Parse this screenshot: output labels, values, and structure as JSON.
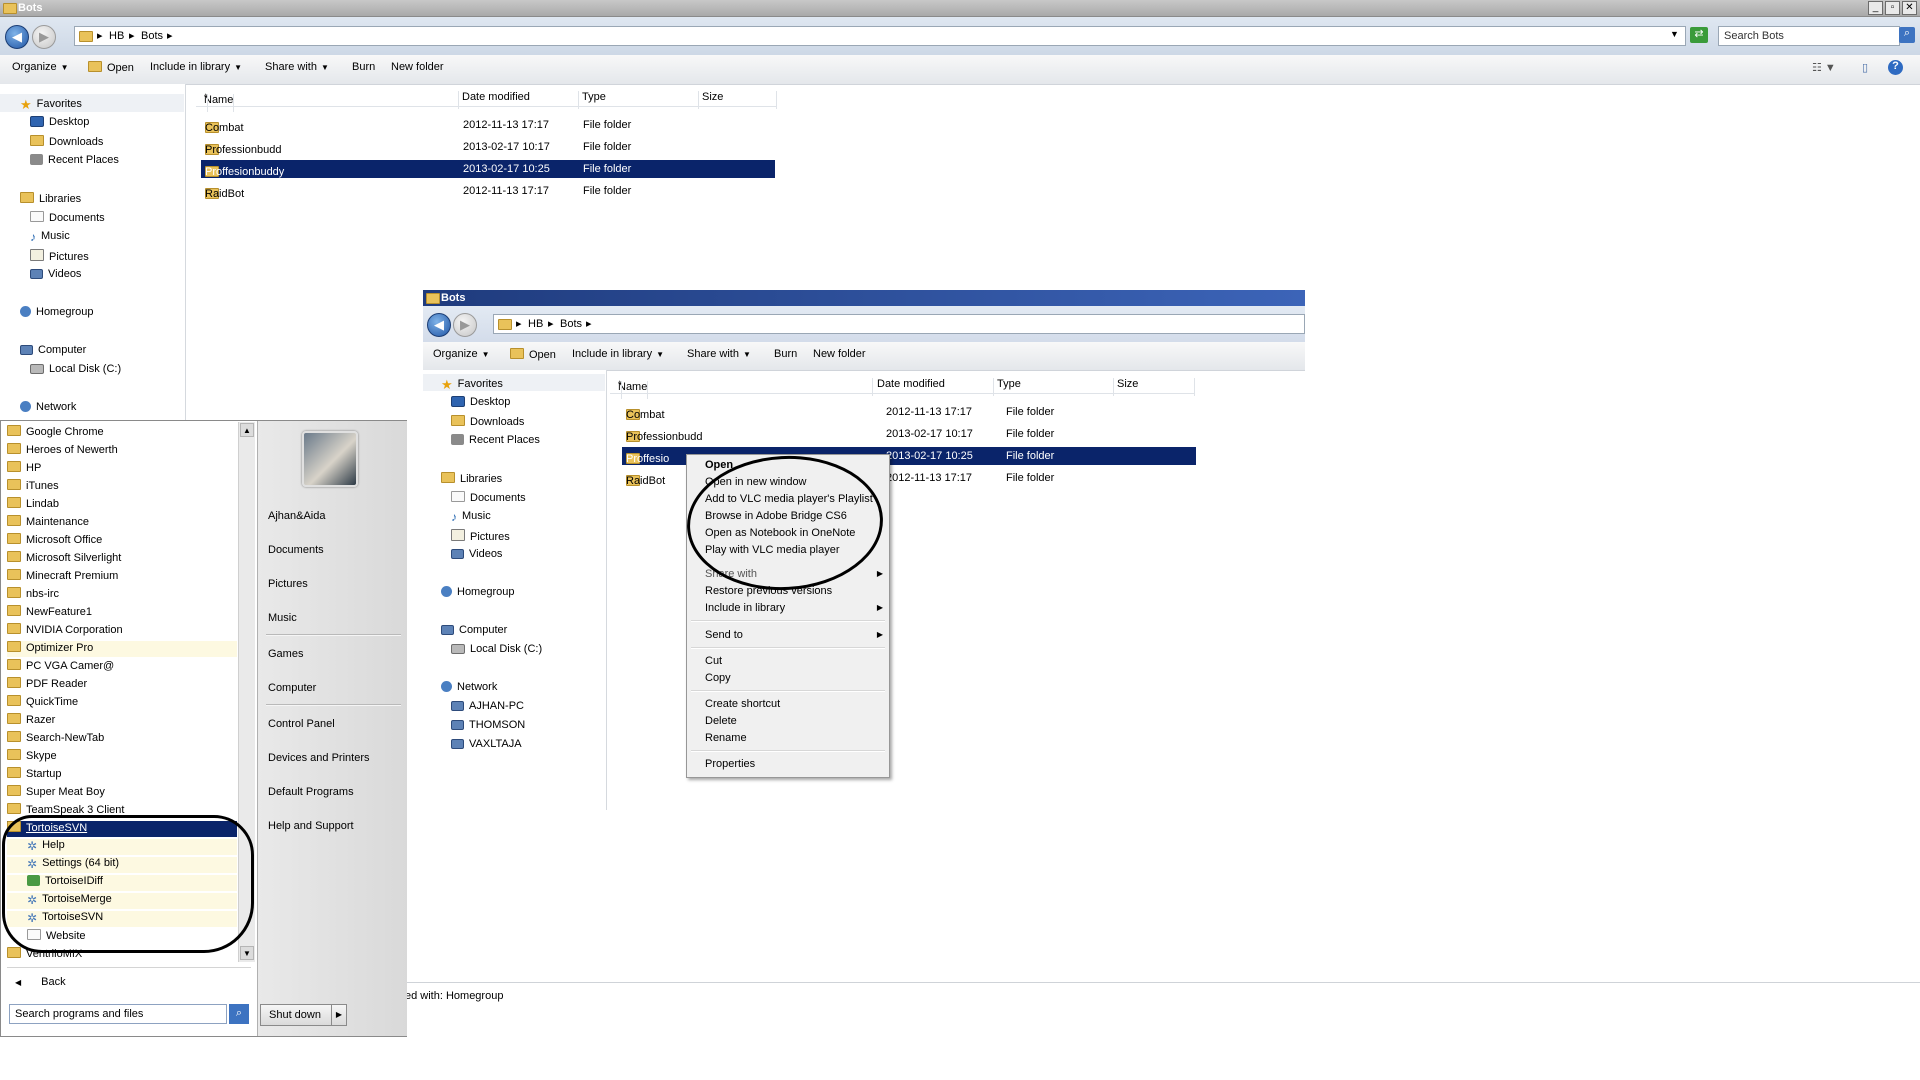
{
  "outer": {
    "title": "Bots",
    "breadcrumb": [
      "HB",
      "Bots"
    ],
    "search_placeholder": "Search Bots",
    "toolbar": {
      "organize": "Organize",
      "open": "Open",
      "include": "Include in library",
      "share": "Share with",
      "burn": "Burn",
      "new_folder": "New folder"
    },
    "nav": {
      "favorites": "Favorites",
      "desktop": "Desktop",
      "downloads": "Downloads",
      "recent": "Recent Places",
      "libraries": "Libraries",
      "documents": "Documents",
      "music": "Music",
      "pictures": "Pictures",
      "videos": "Videos",
      "homegroup": "Homegroup",
      "computer": "Computer",
      "localdisk": "Local Disk (C:)",
      "network": "Network"
    },
    "columns": {
      "name": "Name",
      "date": "Date modified",
      "type": "Type",
      "size": "Size"
    },
    "rows": [
      {
        "name": "Combat",
        "date": "2012-11-13 17:17",
        "type": "File folder"
      },
      {
        "name": "Professionbudd",
        "date": "2013-02-17 10:17",
        "type": "File folder"
      },
      {
        "name": "Proffesionbuddy",
        "date": "2013-02-17 10:25",
        "type": "File folder"
      },
      {
        "name": "RaidBot",
        "date": "2012-11-13 17:17",
        "type": "File folder"
      }
    ]
  },
  "inner": {
    "title": "Bots",
    "breadcrumb": [
      "HB",
      "Bots"
    ],
    "toolbar": {
      "organize": "Organize",
      "open": "Open",
      "include": "Include in library",
      "share": "Share with",
      "burn": "Burn",
      "new_folder": "New folder"
    },
    "nav": {
      "favorites": "Favorites",
      "desktop": "Desktop",
      "downloads": "Downloads",
      "recent": "Recent Places",
      "libraries": "Libraries",
      "documents": "Documents",
      "music": "Music",
      "pictures": "Pictures",
      "videos": "Videos",
      "homegroup": "Homegroup",
      "computer": "Computer",
      "localdisk": "Local Disk (C:)",
      "network": "Network",
      "pc1": "AJHAN-PC",
      "pc2": "THOMSON",
      "pc3": "VAXLTAJA"
    },
    "columns": {
      "name": "Name",
      "date": "Date modified",
      "type": "Type",
      "size": "Size"
    },
    "rows": [
      {
        "name": "Combat",
        "date": "2012-11-13 17:17",
        "type": "File folder"
      },
      {
        "name": "Professionbudd",
        "date": "2013-02-17 10:17",
        "type": "File folder"
      },
      {
        "name": "Proffesio",
        "date": "2013-02-17 10:25",
        "type": "File folder"
      },
      {
        "name": "RaidBot",
        "date": "2012-11-13 17:17",
        "type": "File folder"
      }
    ],
    "status": "ed with: Homegroup"
  },
  "context_menu": {
    "open": "Open",
    "open_new": "Open in new window",
    "vlc_add": "Add to VLC media player's Playlist",
    "bridge": "Browse in Adobe Bridge CS6",
    "onenote": "Open as Notebook in OneNote",
    "vlc_play": "Play with VLC media player",
    "share": "Share with",
    "restore": "Restore previous versions",
    "include": "Include in library",
    "send": "Send to",
    "cut": "Cut",
    "copy": "Copy",
    "shortcut": "Create shortcut",
    "delete": "Delete",
    "rename": "Rename",
    "properties": "Properties"
  },
  "start_menu": {
    "programs": [
      "Google Chrome",
      "Heroes of Newerth",
      "HP",
      "iTunes",
      "Lindab",
      "Maintenance",
      "Microsoft Office",
      "Microsoft Silverlight",
      "Minecraft Premium",
      "nbs-irc",
      "NewFeature1",
      "NVIDIA Corporation",
      "Optimizer Pro",
      "PC VGA Camer@",
      "PDF Reader",
      "QuickTime",
      "Razer",
      "Search-NewTab",
      "Skype",
      "Startup",
      "Super Meat Boy",
      "TeamSpeak 3 Client",
      "TortoiseSVN"
    ],
    "tortoise_items": [
      "Help",
      "Settings (64 bit)",
      "TortoiseIDiff",
      "TortoiseMerge",
      "TortoiseSVN",
      "Website"
    ],
    "last_program": "VentriloMIX",
    "back": "Back",
    "search_placeholder": "Search programs and files",
    "right": {
      "user": "Ajhan&Aida",
      "documents": "Documents",
      "pictures": "Pictures",
      "music": "Music",
      "games": "Games",
      "computer": "Computer",
      "control": "Control Panel",
      "devices": "Devices and Printers",
      "defaults": "Default Programs",
      "help": "Help and Support"
    },
    "shutdown": "Shut down"
  }
}
